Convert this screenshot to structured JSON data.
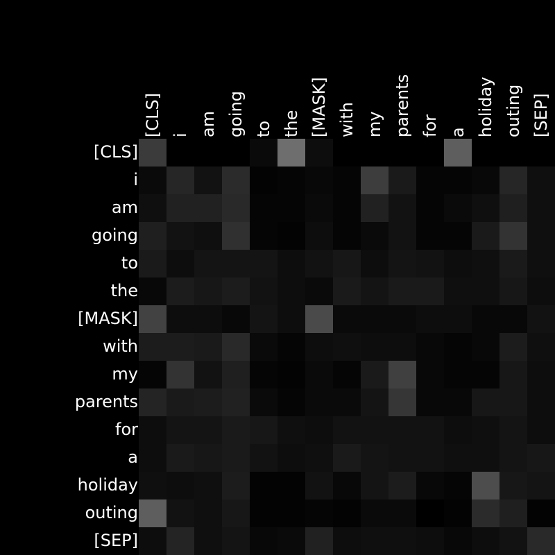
{
  "chart_data": {
    "type": "heatmap",
    "title": "",
    "xlabel": "",
    "ylabel": "",
    "colormap": "grayscale",
    "background_color": "#000000",
    "label_color": "#ffffff",
    "value_range": [
      0,
      1
    ],
    "x_tokens": [
      "[CLS]",
      "i",
      "am",
      "going",
      "to",
      "the",
      "[MASK]",
      "with",
      "my",
      "parents",
      "for",
      "a",
      "holiday",
      "outing",
      "[SEP]"
    ],
    "y_tokens": [
      "[CLS]",
      "i",
      "am",
      "going",
      "to",
      "the",
      "[MASK]",
      "with",
      "my",
      "parents",
      "for",
      "a",
      "holiday",
      "outing",
      "[SEP]"
    ],
    "values": [
      [
        0.23,
        0.0,
        0.0,
        0.0,
        0.04,
        0.43,
        0.05,
        0.0,
        0.0,
        0.0,
        0.0,
        0.37,
        0.0,
        0.0,
        0.0
      ],
      [
        0.04,
        0.15,
        0.07,
        0.17,
        0.01,
        0.02,
        0.03,
        0.02,
        0.24,
        0.1,
        0.02,
        0.02,
        0.03,
        0.15,
        0.06
      ],
      [
        0.06,
        0.13,
        0.13,
        0.16,
        0.02,
        0.02,
        0.04,
        0.02,
        0.13,
        0.07,
        0.02,
        0.04,
        0.06,
        0.12,
        0.06
      ],
      [
        0.12,
        0.07,
        0.06,
        0.19,
        0.02,
        0.01,
        0.05,
        0.02,
        0.04,
        0.07,
        0.02,
        0.02,
        0.1,
        0.2,
        0.06
      ],
      [
        0.1,
        0.05,
        0.08,
        0.08,
        0.08,
        0.05,
        0.07,
        0.09,
        0.05,
        0.08,
        0.07,
        0.05,
        0.06,
        0.1,
        0.06
      ],
      [
        0.03,
        0.11,
        0.09,
        0.11,
        0.07,
        0.05,
        0.04,
        0.1,
        0.08,
        0.1,
        0.1,
        0.06,
        0.06,
        0.09,
        0.05
      ],
      [
        0.26,
        0.05,
        0.05,
        0.03,
        0.08,
        0.05,
        0.29,
        0.04,
        0.04,
        0.04,
        0.05,
        0.05,
        0.03,
        0.03,
        0.07
      ],
      [
        0.11,
        0.11,
        0.1,
        0.16,
        0.04,
        0.02,
        0.05,
        0.06,
        0.05,
        0.05,
        0.03,
        0.02,
        0.03,
        0.11,
        0.06
      ],
      [
        0.02,
        0.2,
        0.07,
        0.12,
        0.02,
        0.01,
        0.04,
        0.02,
        0.1,
        0.25,
        0.03,
        0.02,
        0.02,
        0.09,
        0.05
      ],
      [
        0.14,
        0.1,
        0.11,
        0.13,
        0.04,
        0.02,
        0.04,
        0.04,
        0.08,
        0.21,
        0.03,
        0.03,
        0.09,
        0.09,
        0.05
      ],
      [
        0.05,
        0.08,
        0.08,
        0.1,
        0.09,
        0.06,
        0.05,
        0.07,
        0.07,
        0.07,
        0.07,
        0.05,
        0.06,
        0.08,
        0.05
      ],
      [
        0.05,
        0.1,
        0.09,
        0.1,
        0.07,
        0.05,
        0.06,
        0.1,
        0.08,
        0.07,
        0.07,
        0.06,
        0.06,
        0.08,
        0.09
      ],
      [
        0.06,
        0.05,
        0.06,
        0.11,
        0.01,
        0.01,
        0.07,
        0.03,
        0.08,
        0.11,
        0.03,
        0.02,
        0.3,
        0.09,
        0.08
      ],
      [
        0.37,
        0.07,
        0.06,
        0.09,
        0.01,
        0.01,
        0.02,
        0.01,
        0.04,
        0.04,
        0.0,
        0.01,
        0.17,
        0.12,
        0.01
      ],
      [
        0.05,
        0.14,
        0.06,
        0.08,
        0.03,
        0.04,
        0.13,
        0.05,
        0.06,
        0.06,
        0.05,
        0.03,
        0.05,
        0.07,
        0.16
      ]
    ]
  }
}
